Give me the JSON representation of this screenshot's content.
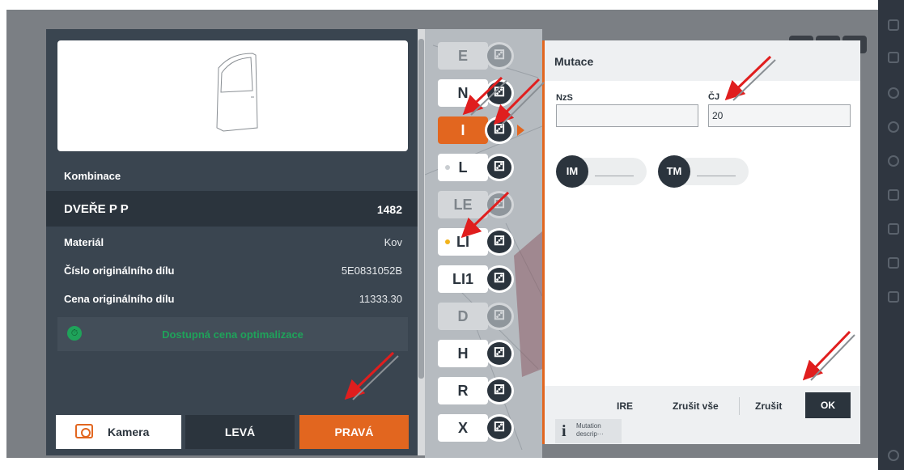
{
  "part_panel": {
    "combination_label": "Kombinace",
    "part_name": "DVEŘE P P",
    "part_code": "1482",
    "rows": [
      {
        "label": "Materiál",
        "value": "Kov"
      },
      {
        "label": "Číslo originálního dílu",
        "value": "5E0831052B"
      },
      {
        "label": "Cena originálního dílu",
        "value": "11333.30"
      }
    ],
    "price_optimization": "Dostupná cena optimalizace",
    "buttons": {
      "camera": "Kamera",
      "left": "LEVÁ",
      "right": "PRAVÁ"
    }
  },
  "view_tiles": [
    {
      "label": "E",
      "state": "disabled",
      "dot": false
    },
    {
      "label": "N",
      "state": "normal",
      "dot": false
    },
    {
      "label": "I",
      "state": "active",
      "dot": false
    },
    {
      "label": "L",
      "state": "normal",
      "dot": "#c9cdd1"
    },
    {
      "label": "LE",
      "state": "disabled",
      "dot": false
    },
    {
      "label": "LI",
      "state": "normal",
      "dot": "#f2b31b"
    },
    {
      "label": "LI1",
      "state": "normal",
      "dot": false
    },
    {
      "label": "D",
      "state": "disabled",
      "dot": false
    },
    {
      "label": "H",
      "state": "normal",
      "dot": false
    },
    {
      "label": "R",
      "state": "normal",
      "dot": false
    },
    {
      "label": "X",
      "state": "normal",
      "dot": false
    }
  ],
  "mutace": {
    "title": "Mutace",
    "nzs_label": "NzS",
    "nzs_value": "",
    "cj_label": "ČJ",
    "cj_value": "20",
    "im_label": "IM",
    "tm_label": "TM",
    "footer": {
      "ire": "IRE",
      "cancel_all": "Zrušit vše",
      "cancel": "Zrušit",
      "ok": "OK",
      "description_line1": "Mutation",
      "description_line2": "descrip···"
    }
  },
  "colors": {
    "accent": "#e2661f",
    "dark": "#2b343d",
    "panel": "#3a4550",
    "success": "#1fa35a",
    "annotation_arrow": "#e01e1e"
  },
  "icons": [
    "camera-icon",
    "price-optimization-icon",
    "view-toggle-icon",
    "info-icon",
    "menu-icon"
  ]
}
